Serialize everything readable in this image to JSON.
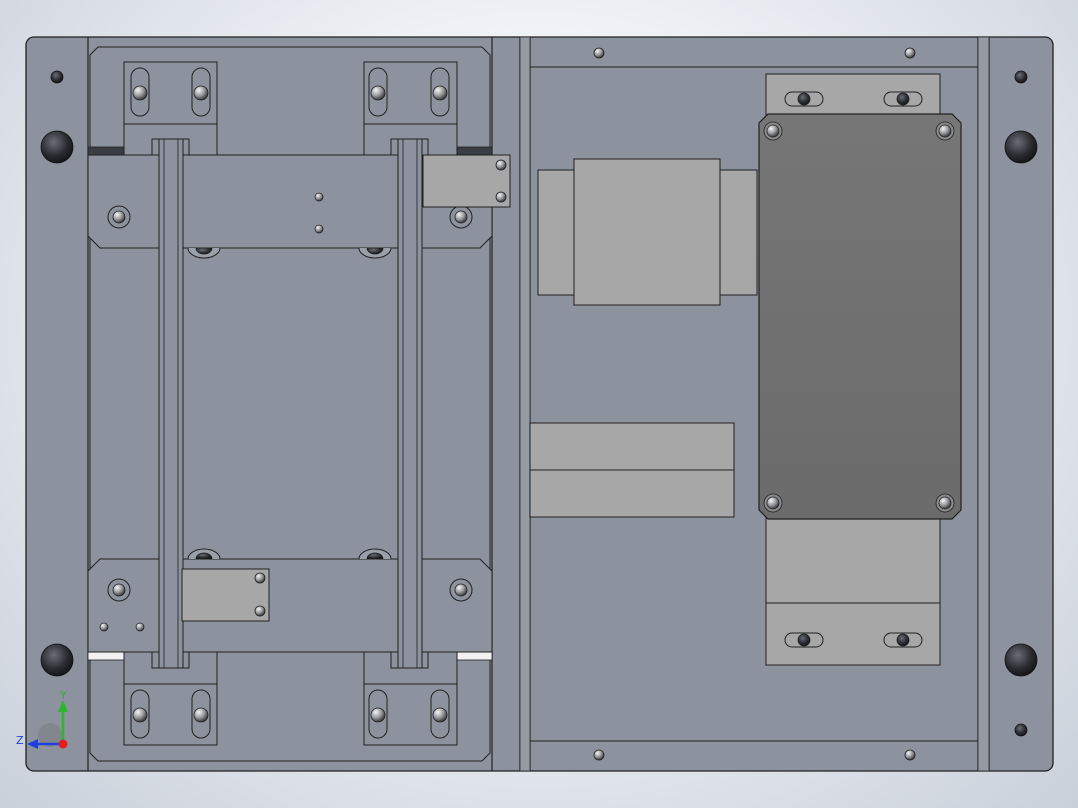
{
  "viewport": {
    "background_top": "#ffffff",
    "background_edge": "#c9d0da"
  },
  "colors": {
    "plate": "#8d939e",
    "plate_inner": "#8a909b",
    "edge": "#202020",
    "block": "#a7a7a7",
    "pad": "#6f6f6f",
    "hole_dark": "#2a2c31",
    "shaft": "#9ea3ab"
  },
  "triad": {
    "y_label": "Y",
    "z_label": "Z",
    "y_color": "#2db52d",
    "z_color": "#1f3fe0",
    "x_color": "#e01f1f"
  }
}
